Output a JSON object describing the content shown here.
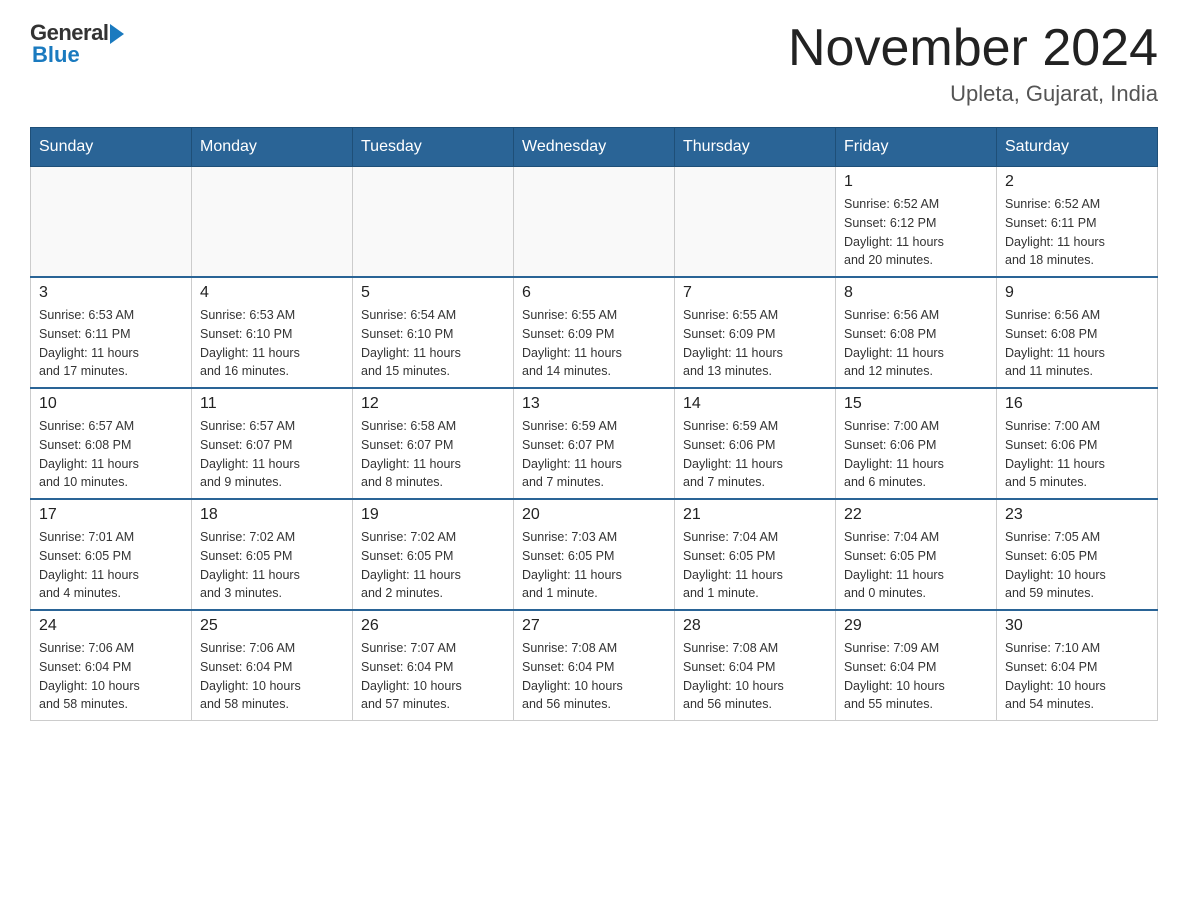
{
  "header": {
    "logo_general": "General",
    "logo_blue": "Blue",
    "title": "November 2024",
    "subtitle": "Upleta, Gujarat, India"
  },
  "days_of_week": [
    "Sunday",
    "Monday",
    "Tuesday",
    "Wednesday",
    "Thursday",
    "Friday",
    "Saturday"
  ],
  "weeks": [
    {
      "cells": [
        {
          "day": "",
          "info": ""
        },
        {
          "day": "",
          "info": ""
        },
        {
          "day": "",
          "info": ""
        },
        {
          "day": "",
          "info": ""
        },
        {
          "day": "",
          "info": ""
        },
        {
          "day": "1",
          "info": "Sunrise: 6:52 AM\nSunset: 6:12 PM\nDaylight: 11 hours\nand 20 minutes."
        },
        {
          "day": "2",
          "info": "Sunrise: 6:52 AM\nSunset: 6:11 PM\nDaylight: 11 hours\nand 18 minutes."
        }
      ]
    },
    {
      "cells": [
        {
          "day": "3",
          "info": "Sunrise: 6:53 AM\nSunset: 6:11 PM\nDaylight: 11 hours\nand 17 minutes."
        },
        {
          "day": "4",
          "info": "Sunrise: 6:53 AM\nSunset: 6:10 PM\nDaylight: 11 hours\nand 16 minutes."
        },
        {
          "day": "5",
          "info": "Sunrise: 6:54 AM\nSunset: 6:10 PM\nDaylight: 11 hours\nand 15 minutes."
        },
        {
          "day": "6",
          "info": "Sunrise: 6:55 AM\nSunset: 6:09 PM\nDaylight: 11 hours\nand 14 minutes."
        },
        {
          "day": "7",
          "info": "Sunrise: 6:55 AM\nSunset: 6:09 PM\nDaylight: 11 hours\nand 13 minutes."
        },
        {
          "day": "8",
          "info": "Sunrise: 6:56 AM\nSunset: 6:08 PM\nDaylight: 11 hours\nand 12 minutes."
        },
        {
          "day": "9",
          "info": "Sunrise: 6:56 AM\nSunset: 6:08 PM\nDaylight: 11 hours\nand 11 minutes."
        }
      ]
    },
    {
      "cells": [
        {
          "day": "10",
          "info": "Sunrise: 6:57 AM\nSunset: 6:08 PM\nDaylight: 11 hours\nand 10 minutes."
        },
        {
          "day": "11",
          "info": "Sunrise: 6:57 AM\nSunset: 6:07 PM\nDaylight: 11 hours\nand 9 minutes."
        },
        {
          "day": "12",
          "info": "Sunrise: 6:58 AM\nSunset: 6:07 PM\nDaylight: 11 hours\nand 8 minutes."
        },
        {
          "day": "13",
          "info": "Sunrise: 6:59 AM\nSunset: 6:07 PM\nDaylight: 11 hours\nand 7 minutes."
        },
        {
          "day": "14",
          "info": "Sunrise: 6:59 AM\nSunset: 6:06 PM\nDaylight: 11 hours\nand 7 minutes."
        },
        {
          "day": "15",
          "info": "Sunrise: 7:00 AM\nSunset: 6:06 PM\nDaylight: 11 hours\nand 6 minutes."
        },
        {
          "day": "16",
          "info": "Sunrise: 7:00 AM\nSunset: 6:06 PM\nDaylight: 11 hours\nand 5 minutes."
        }
      ]
    },
    {
      "cells": [
        {
          "day": "17",
          "info": "Sunrise: 7:01 AM\nSunset: 6:05 PM\nDaylight: 11 hours\nand 4 minutes."
        },
        {
          "day": "18",
          "info": "Sunrise: 7:02 AM\nSunset: 6:05 PM\nDaylight: 11 hours\nand 3 minutes."
        },
        {
          "day": "19",
          "info": "Sunrise: 7:02 AM\nSunset: 6:05 PM\nDaylight: 11 hours\nand 2 minutes."
        },
        {
          "day": "20",
          "info": "Sunrise: 7:03 AM\nSunset: 6:05 PM\nDaylight: 11 hours\nand 1 minute."
        },
        {
          "day": "21",
          "info": "Sunrise: 7:04 AM\nSunset: 6:05 PM\nDaylight: 11 hours\nand 1 minute."
        },
        {
          "day": "22",
          "info": "Sunrise: 7:04 AM\nSunset: 6:05 PM\nDaylight: 11 hours\nand 0 minutes."
        },
        {
          "day": "23",
          "info": "Sunrise: 7:05 AM\nSunset: 6:05 PM\nDaylight: 10 hours\nand 59 minutes."
        }
      ]
    },
    {
      "cells": [
        {
          "day": "24",
          "info": "Sunrise: 7:06 AM\nSunset: 6:04 PM\nDaylight: 10 hours\nand 58 minutes."
        },
        {
          "day": "25",
          "info": "Sunrise: 7:06 AM\nSunset: 6:04 PM\nDaylight: 10 hours\nand 58 minutes."
        },
        {
          "day": "26",
          "info": "Sunrise: 7:07 AM\nSunset: 6:04 PM\nDaylight: 10 hours\nand 57 minutes."
        },
        {
          "day": "27",
          "info": "Sunrise: 7:08 AM\nSunset: 6:04 PM\nDaylight: 10 hours\nand 56 minutes."
        },
        {
          "day": "28",
          "info": "Sunrise: 7:08 AM\nSunset: 6:04 PM\nDaylight: 10 hours\nand 56 minutes."
        },
        {
          "day": "29",
          "info": "Sunrise: 7:09 AM\nSunset: 6:04 PM\nDaylight: 10 hours\nand 55 minutes."
        },
        {
          "day": "30",
          "info": "Sunrise: 7:10 AM\nSunset: 6:04 PM\nDaylight: 10 hours\nand 54 minutes."
        }
      ]
    }
  ]
}
